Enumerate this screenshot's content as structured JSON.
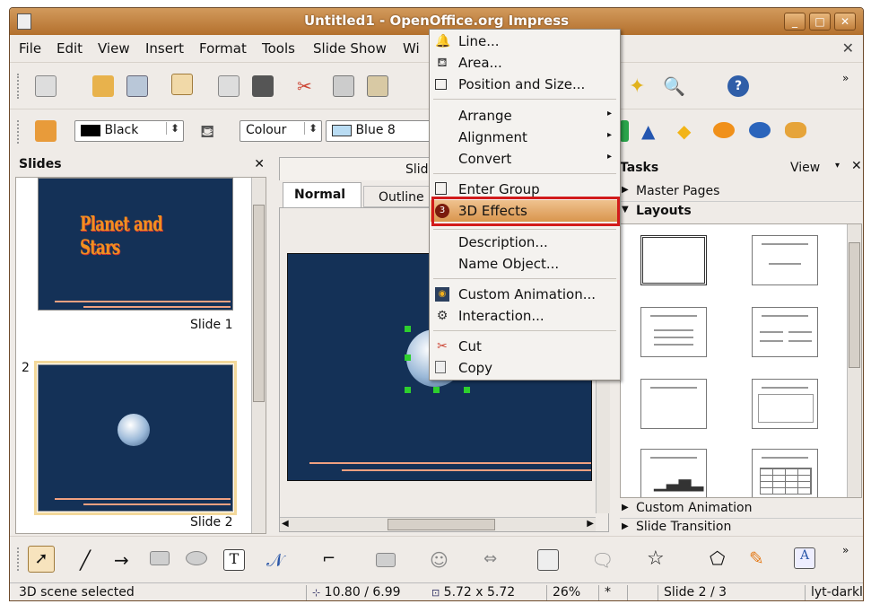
{
  "window": {
    "title": "Untitled1 - OpenOffice.org Impress"
  },
  "menubar": {
    "items": [
      "File",
      "Edit",
      "View",
      "Insert",
      "Format",
      "Tools",
      "Slide Show",
      "Wi"
    ]
  },
  "toolbar2": {
    "color_name": "Black",
    "fill_mode": "Colour",
    "fill_color": "Blue 8"
  },
  "slides_panel": {
    "title": "Slides",
    "slides": [
      {
        "number": "",
        "label": "Slide 1",
        "title_art": "Planet and Stars"
      },
      {
        "number": "2",
        "label": "Slide 2"
      }
    ]
  },
  "editor": {
    "tab_header": "Slid",
    "tabs": [
      "Normal",
      "Outline"
    ]
  },
  "tasks_panel": {
    "title": "Tasks",
    "view_label": "View",
    "sections": [
      "Master Pages",
      "Layouts",
      "Custom Animation",
      "Slide Transition"
    ]
  },
  "context_menu": {
    "items": [
      {
        "label": "Line...",
        "icon": "line-icon",
        "group": 1
      },
      {
        "label": "Area...",
        "icon": "area-icon",
        "group": 1
      },
      {
        "label": "Position and Size...",
        "icon": "position-size-icon",
        "group": 1
      },
      {
        "label": "Arrange",
        "submenu": true,
        "group": 2
      },
      {
        "label": "Alignment",
        "submenu": true,
        "group": 2
      },
      {
        "label": "Convert",
        "submenu": true,
        "group": 2
      },
      {
        "label": "Enter Group",
        "icon": "enter-group-icon",
        "group": 3
      },
      {
        "label": "3D Effects",
        "icon": "3d-effects-icon",
        "group": 3,
        "highlighted": true
      },
      {
        "label": "Description...",
        "group": 4
      },
      {
        "label": "Name Object...",
        "group": 4
      },
      {
        "label": "Custom Animation...",
        "icon": "custom-animation-icon",
        "group": 5
      },
      {
        "label": "Interaction...",
        "icon": "interaction-icon",
        "group": 5
      },
      {
        "label": "Cut",
        "icon": "cut-icon",
        "group": 6
      },
      {
        "label": "Copy",
        "icon": "copy-icon",
        "group": 6
      }
    ]
  },
  "statusbar": {
    "status": "3D scene selected",
    "position": "10.80 / 6.99",
    "size": "5.72 x 5.72",
    "zoom": "26%",
    "modified": "*",
    "slide": "Slide 2 / 3",
    "layout": "lyt-darkl"
  },
  "colors": {
    "title_bar": "#b3702d",
    "slide_bg": "#143157",
    "highlight_box": "#d21b1b",
    "menu_hover": "#d9954d"
  }
}
